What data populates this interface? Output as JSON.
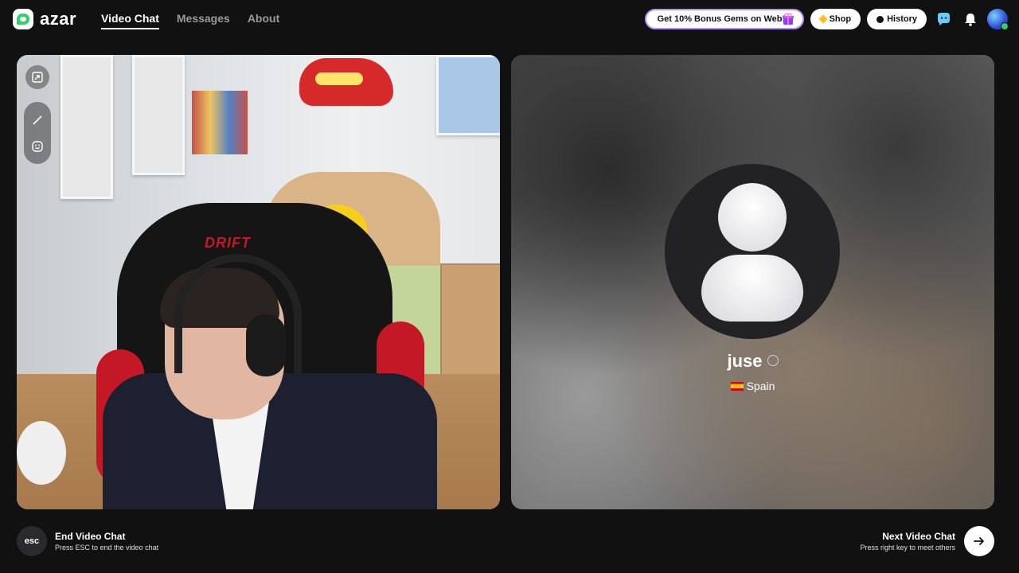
{
  "header": {
    "logo_text": "azar",
    "nav": [
      {
        "label": "Video Chat",
        "active": true
      },
      {
        "label": "Messages",
        "active": false
      },
      {
        "label": "About",
        "active": false
      }
    ],
    "promo_label": "Get 10% Bonus Gems on Web!",
    "shop_label": "Shop",
    "history_label": "History",
    "icons": [
      "gift-icon",
      "gem-icon",
      "clock-icon",
      "chat-bubble-icon",
      "bell-icon",
      "avatar"
    ]
  },
  "self_video": {
    "overlay_text": "DRIFT",
    "tools": [
      "pip-icon",
      "magic-wand-icon",
      "smiley-icon"
    ]
  },
  "remote_video": {
    "name": "juse",
    "country": "Spain",
    "flag": "spain-flag-icon"
  },
  "footer": {
    "esc_key": "esc",
    "end_title": "End Video Chat",
    "end_subtitle": "Press ESC to end the video chat",
    "next_title": "Next Video Chat",
    "next_subtitle": "Press right key to meet others"
  },
  "colors": {
    "background": "#111112",
    "accent_green": "#2fd16a",
    "gem_yellow": "#ffc21f",
    "promo_border": "#b48cff"
  }
}
